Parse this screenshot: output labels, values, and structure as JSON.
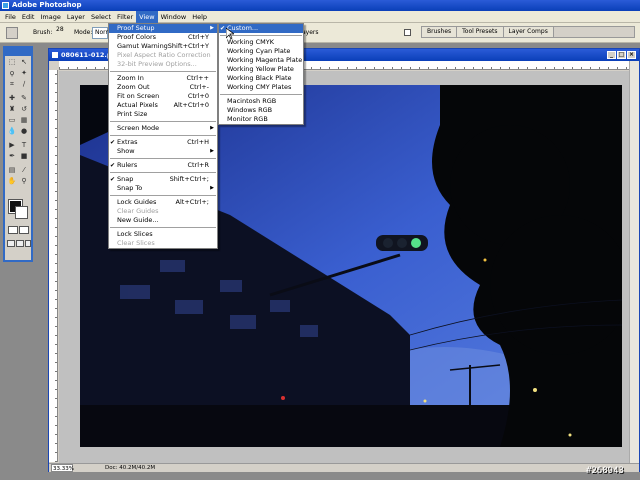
{
  "app": {
    "title": "Adobe Photoshop"
  },
  "menubar": {
    "items": [
      "File",
      "Edit",
      "Image",
      "Layer",
      "Select",
      "Filter",
      "View",
      "Window",
      "Help"
    ]
  },
  "options_bar": {
    "brush_label": "Brush:",
    "brush_size": "28",
    "mode_label": "Mode:",
    "mode_value": "Norm",
    "layers_label": "ayers"
  },
  "palette_well": {
    "tabs": [
      "Brushes",
      "Tool Presets",
      "Layer Comps"
    ]
  },
  "document": {
    "title": "080611-012.psd",
    "zoom": "33.33%",
    "doc_size": "Doc: 40.2M/40.2M"
  },
  "view_menu": [
    {
      "label": "Proof Setup",
      "shortcut": "",
      "arrow": true,
      "highlighted": true,
      "disabled": false,
      "checked": false
    },
    {
      "label": "Proof Colors",
      "shortcut": "Ctrl+Y",
      "arrow": false,
      "highlighted": false,
      "disabled": false,
      "checked": false
    },
    {
      "label": "Gamut Warning",
      "shortcut": "Shift+Ctrl+Y",
      "arrow": false,
      "highlighted": false,
      "disabled": false,
      "checked": false
    },
    {
      "label": "Pixel Aspect Ratio Correction",
      "shortcut": "",
      "arrow": false,
      "highlighted": false,
      "disabled": true,
      "checked": false
    },
    {
      "label": "32-bit Preview Options...",
      "shortcut": "",
      "arrow": false,
      "highlighted": false,
      "disabled": true,
      "checked": false
    },
    {
      "sep": true
    },
    {
      "label": "Zoom In",
      "shortcut": "Ctrl++",
      "arrow": false,
      "highlighted": false,
      "disabled": false,
      "checked": false
    },
    {
      "label": "Zoom Out",
      "shortcut": "Ctrl+-",
      "arrow": false,
      "highlighted": false,
      "disabled": false,
      "checked": false
    },
    {
      "label": "Fit on Screen",
      "shortcut": "Ctrl+0",
      "arrow": false,
      "highlighted": false,
      "disabled": false,
      "checked": false
    },
    {
      "label": "Actual Pixels",
      "shortcut": "Alt+Ctrl+0",
      "arrow": false,
      "highlighted": false,
      "disabled": false,
      "checked": false
    },
    {
      "label": "Print Size",
      "shortcut": "",
      "arrow": false,
      "highlighted": false,
      "disabled": false,
      "checked": false
    },
    {
      "sep": true
    },
    {
      "label": "Screen Mode",
      "shortcut": "",
      "arrow": true,
      "highlighted": false,
      "disabled": false,
      "checked": false
    },
    {
      "sep": true
    },
    {
      "label": "Extras",
      "shortcut": "Ctrl+H",
      "arrow": false,
      "highlighted": false,
      "disabled": false,
      "checked": true
    },
    {
      "label": "Show",
      "shortcut": "",
      "arrow": true,
      "highlighted": false,
      "disabled": false,
      "checked": false
    },
    {
      "sep": true
    },
    {
      "label": "Rulers",
      "shortcut": "Ctrl+R",
      "arrow": false,
      "highlighted": false,
      "disabled": false,
      "checked": true
    },
    {
      "sep": true
    },
    {
      "label": "Snap",
      "shortcut": "Shift+Ctrl+;",
      "arrow": false,
      "highlighted": false,
      "disabled": false,
      "checked": true
    },
    {
      "label": "Snap To",
      "shortcut": "",
      "arrow": true,
      "highlighted": false,
      "disabled": false,
      "checked": false
    },
    {
      "sep": true
    },
    {
      "label": "Lock Guides",
      "shortcut": "Alt+Ctrl+;",
      "arrow": false,
      "highlighted": false,
      "disabled": false,
      "checked": false
    },
    {
      "label": "Clear Guides",
      "shortcut": "",
      "arrow": false,
      "highlighted": false,
      "disabled": true,
      "checked": false
    },
    {
      "label": "New Guide...",
      "shortcut": "",
      "arrow": false,
      "highlighted": false,
      "disabled": false,
      "checked": false
    },
    {
      "sep": true
    },
    {
      "label": "Lock Slices",
      "shortcut": "",
      "arrow": false,
      "highlighted": false,
      "disabled": false,
      "checked": false
    },
    {
      "label": "Clear Slices",
      "shortcut": "",
      "arrow": false,
      "highlighted": false,
      "disabled": true,
      "checked": false
    }
  ],
  "proof_setup_menu": [
    {
      "label": "Custom...",
      "highlighted": true,
      "checked": true
    },
    {
      "sep": true
    },
    {
      "label": "Working CMYK",
      "highlighted": false,
      "checked": false
    },
    {
      "label": "Working Cyan Plate",
      "highlighted": false,
      "checked": false
    },
    {
      "label": "Working Magenta Plate",
      "highlighted": false,
      "checked": false
    },
    {
      "label": "Working Yellow Plate",
      "highlighted": false,
      "checked": false
    },
    {
      "label": "Working Black Plate",
      "highlighted": false,
      "checked": false
    },
    {
      "label": "Working CMY Plates",
      "highlighted": false,
      "checked": false
    },
    {
      "sep": true
    },
    {
      "label": "Macintosh RGB",
      "highlighted": false,
      "checked": false
    },
    {
      "label": "Windows RGB",
      "highlighted": false,
      "checked": false
    },
    {
      "label": "Monitor RGB",
      "highlighted": false,
      "checked": false
    }
  ],
  "watermark": "#268943",
  "colors": {
    "accent": "#316ac5",
    "titlebar": "#0a3fb8",
    "menu_bg": "#ece9d8"
  },
  "icons": [
    "move-tool-icon",
    "marquee-tool-icon",
    "lasso-tool-icon",
    "magic-wand-icon",
    "crop-tool-icon",
    "slice-tool-icon",
    "healing-brush-icon",
    "brush-tool-icon",
    "clone-stamp-icon",
    "history-brush-icon",
    "eraser-icon",
    "gradient-icon",
    "blur-icon",
    "dodge-icon",
    "path-selection-icon",
    "type-tool-icon",
    "pen-tool-icon",
    "shape-tool-icon",
    "notes-icon",
    "eyedropper-icon",
    "hand-tool-icon",
    "zoom-tool-icon"
  ]
}
